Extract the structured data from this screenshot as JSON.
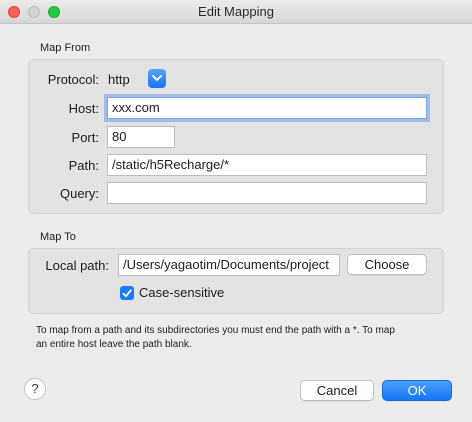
{
  "window": {
    "title": "Edit Mapping"
  },
  "map_from": {
    "section_title": "Map From",
    "protocol": {
      "label": "Protocol:",
      "value": "http"
    },
    "host": {
      "label": "Host:",
      "value": "xxx.com"
    },
    "port": {
      "label": "Port:",
      "value": "80"
    },
    "path": {
      "label": "Path:",
      "value": "/static/h5Recharge/*"
    },
    "query": {
      "label": "Query:",
      "value": ""
    }
  },
  "map_to": {
    "section_title": "Map To",
    "local_path": {
      "label": "Local path:",
      "value": "/Users/yagaotim/Documents/project"
    },
    "choose_label": "Choose",
    "case_sensitive": {
      "label": "Case-sensitive",
      "checked": true
    }
  },
  "note": {
    "line1": "To map from a path and its subdirectories you must end the path with a *. To map",
    "line2": "an entire host leave the path blank."
  },
  "footer": {
    "help_label": "?",
    "cancel_label": "Cancel",
    "ok_label": "OK"
  },
  "colors": {
    "accent": "#1b7cf4",
    "focus_ring": "#7aa7e6"
  }
}
